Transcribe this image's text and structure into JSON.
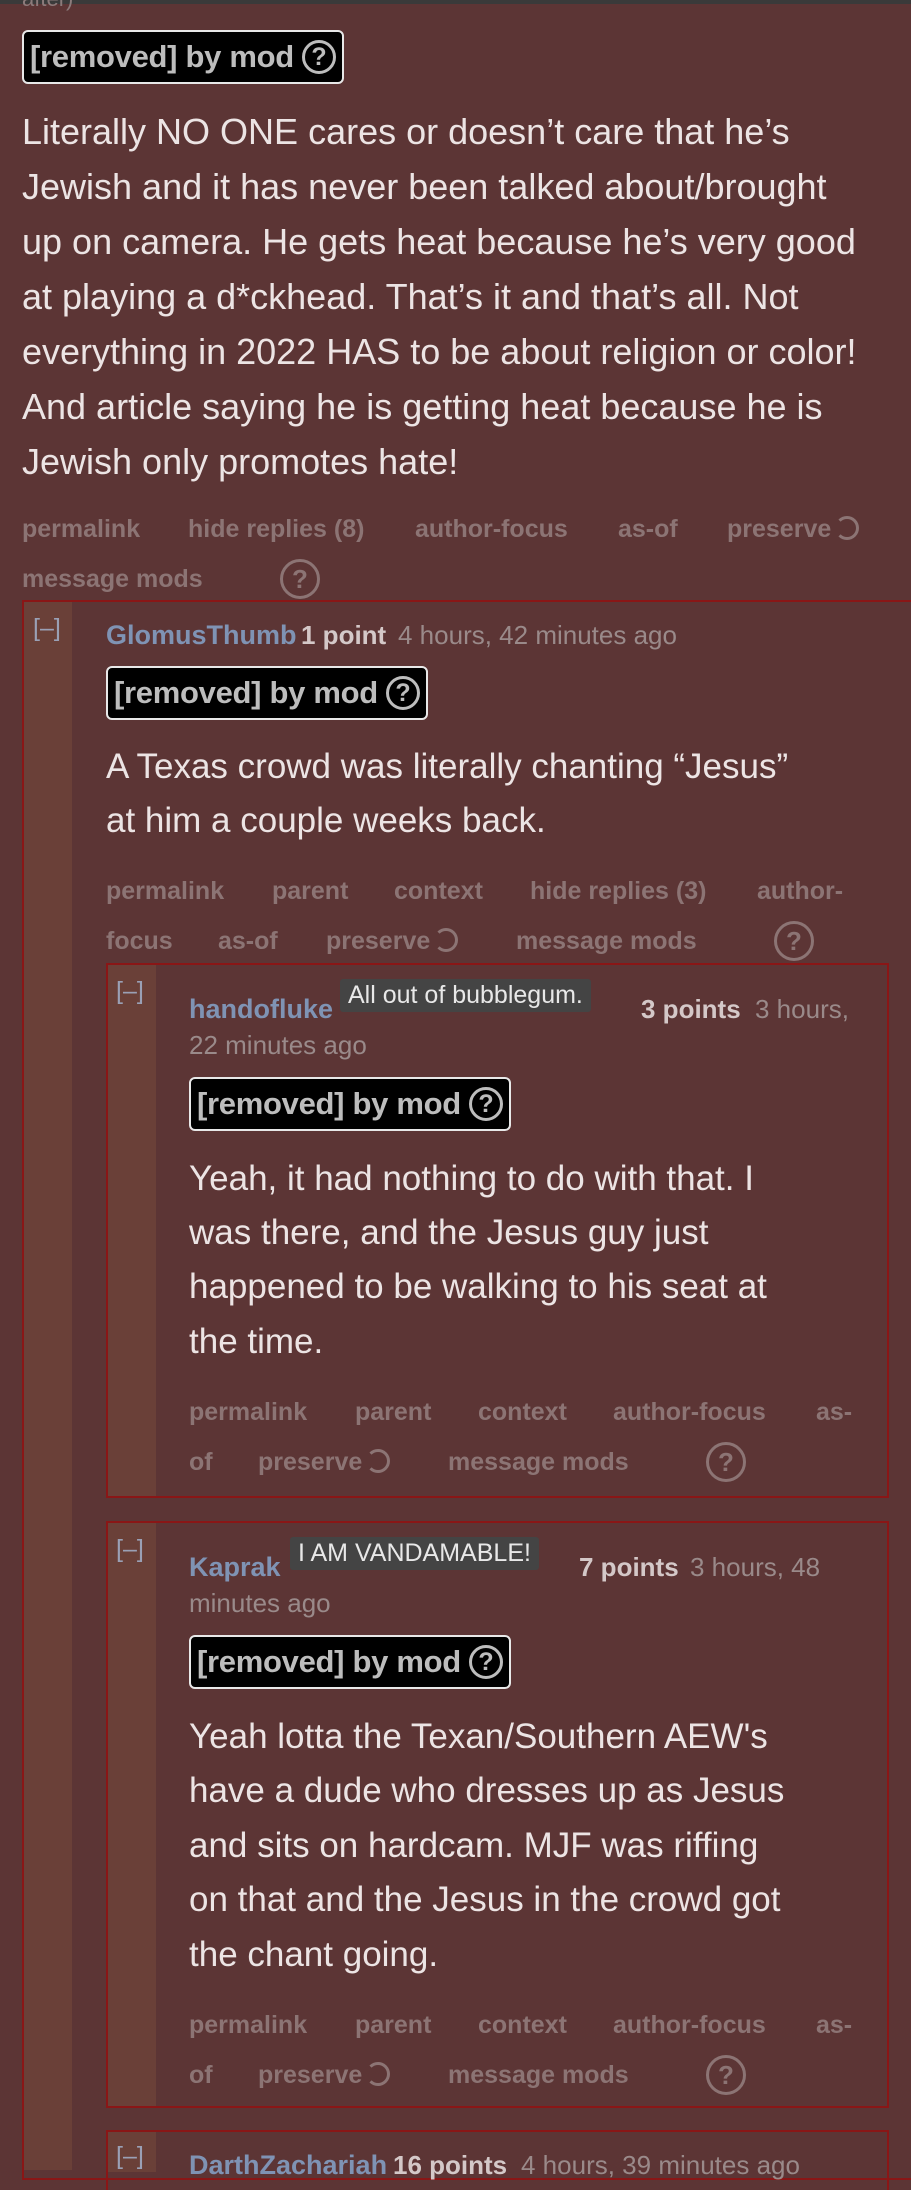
{
  "top_fragment": "after)",
  "removed_label": "[removed] by mod",
  "root_comment": {
    "lines": [
      "Literally NO ONE cares or doesn’t care that he’s",
      "Jewish and it has never been talked about/brought",
      "up on camera. He gets heat because he’s very good",
      "at playing a d*ckhead. That’s it and that’s all. Not",
      "everything in 2022 HAS to be about religion or color!",
      "And article saying he is getting heat because he is",
      "Jewish only promotes hate!"
    ],
    "actions": {
      "permalink": "permalink",
      "hide_replies": "hide replies (8)",
      "author_focus": "author-focus",
      "as_of": "as-of",
      "preserve": "preserve",
      "message_mods": "message mods"
    }
  },
  "reply1": {
    "collapse": "[–]",
    "author": "GlomusThumb",
    "score": "1 point",
    "time": "4 hours, 42 minutes ago",
    "lines": [
      "A Texas crowd was literally chanting “Jesus”",
      "at him a couple weeks back."
    ],
    "actions": {
      "permalink": "permalink",
      "parent": "parent",
      "context": "context",
      "hide_replies": "hide replies (3)",
      "author_focus_a": "author-",
      "author_focus_b": "focus",
      "as_of": "as-of",
      "preserve": "preserve",
      "message_mods": "message mods"
    }
  },
  "reply2": {
    "collapse": "[–]",
    "author": "handofluke",
    "flair": "All out of bubblegum.",
    "score": "3 points",
    "time_a": "3 hours,",
    "time_b": "22 minutes ago",
    "lines": [
      "Yeah, it had nothing to do with that. I",
      "was there, and the Jesus guy just",
      "happened to be walking to his seat at",
      "the time."
    ],
    "actions": {
      "permalink": "permalink",
      "parent": "parent",
      "context": "context",
      "author_focus": "author-focus",
      "as_of_a": "as-",
      "as_of_b": "of",
      "preserve": "preserve",
      "message_mods": "message mods"
    }
  },
  "reply3": {
    "collapse": "[–]",
    "author": "Kaprak",
    "flair": "I AM VANDAMABLE!",
    "score": "7 points",
    "time_a": "3 hours, 48",
    "time_b": "minutes ago",
    "lines": [
      "Yeah lotta the Texan/Southern AEW's",
      "have a dude who dresses up as Jesus",
      "and sits on hardcam. MJF was riffing",
      "on that and the Jesus in the crowd got",
      "the chant going."
    ],
    "actions": {
      "permalink": "permalink",
      "parent": "parent",
      "context": "context",
      "author_focus": "author-focus",
      "as_of_a": "as-",
      "as_of_b": "of",
      "preserve": "preserve",
      "message_mods": "message mods"
    }
  },
  "reply4": {
    "collapse": "[–]",
    "author": "DarthZachariah",
    "score": "16 points",
    "time": "4 hours, 39 minutes ago"
  },
  "icons": {
    "help": "?",
    "preserve": "refresh-icon"
  }
}
